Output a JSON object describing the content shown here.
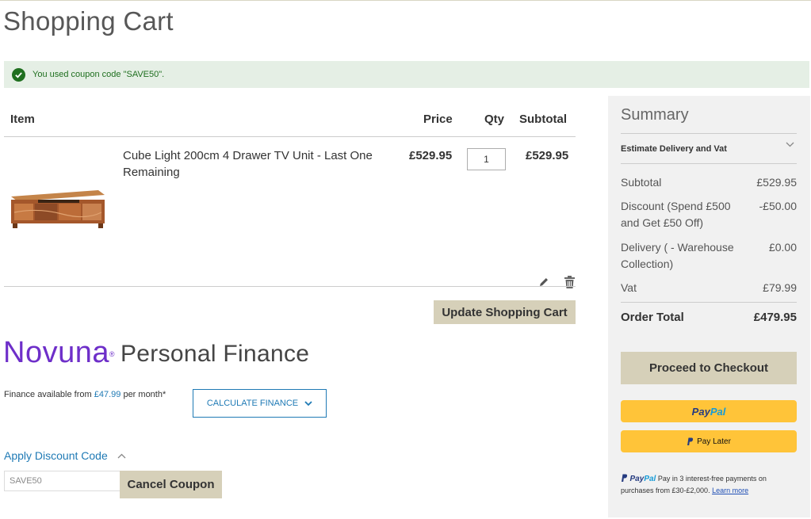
{
  "page": {
    "title": "Shopping Cart"
  },
  "message": {
    "text": "You used coupon code \"SAVE50\"."
  },
  "cart": {
    "headers": {
      "item": "Item",
      "price": "Price",
      "qty": "Qty",
      "subtotal": "Subtotal"
    },
    "items": [
      {
        "name": "Cube Light 200cm 4 Drawer TV Unit - Last One Remaining",
        "price": "£529.95",
        "qty": "1",
        "subtotal": "£529.95"
      }
    ],
    "update_label": "Update Shopping Cart"
  },
  "finance": {
    "brand": "Novuna",
    "brand_suffix": "Personal Finance",
    "prefix": "Finance available from ",
    "amount": "£47.99",
    "suffix": " per month*",
    "button_label": "CALCULATE FINANCE"
  },
  "discount": {
    "link_label": "Apply Discount Code",
    "code_value": "SAVE50",
    "cancel_label": "Cancel Coupon"
  },
  "summary": {
    "title": "Summary",
    "estimate_label": "Estimate Delivery and Vat",
    "rows": [
      {
        "label": "Subtotal",
        "value": "£529.95"
      },
      {
        "label": "Discount (Spend £500 and Get £50 Off)",
        "value": "-£50.00"
      },
      {
        "label": "Delivery ( - Warehouse Collection)",
        "value": "£0.00"
      },
      {
        "label": "Vat",
        "value": "£79.99"
      }
    ],
    "total_label": "Order Total",
    "total_value": "£479.95",
    "checkout_label": "Proceed to Checkout",
    "paypal_pay": "Pay",
    "paypal_pal": "Pal",
    "paylater_label": "Pay Later",
    "pp_msg_text": " Pay in 3 interest-free payments on purchases from £30-£2,000. ",
    "pp_learn": "Learn more"
  },
  "colors": {
    "accent": "#1f7ab5",
    "button": "#d6d0b9",
    "success": "#1f6f1f",
    "paypal": "#ffc439",
    "novuna": "#6e2fc9"
  },
  "icons": [
    "check-icon",
    "edit-icon",
    "trash-icon",
    "chevron-down-icon",
    "chevron-up-icon",
    "paypal-icon"
  ]
}
